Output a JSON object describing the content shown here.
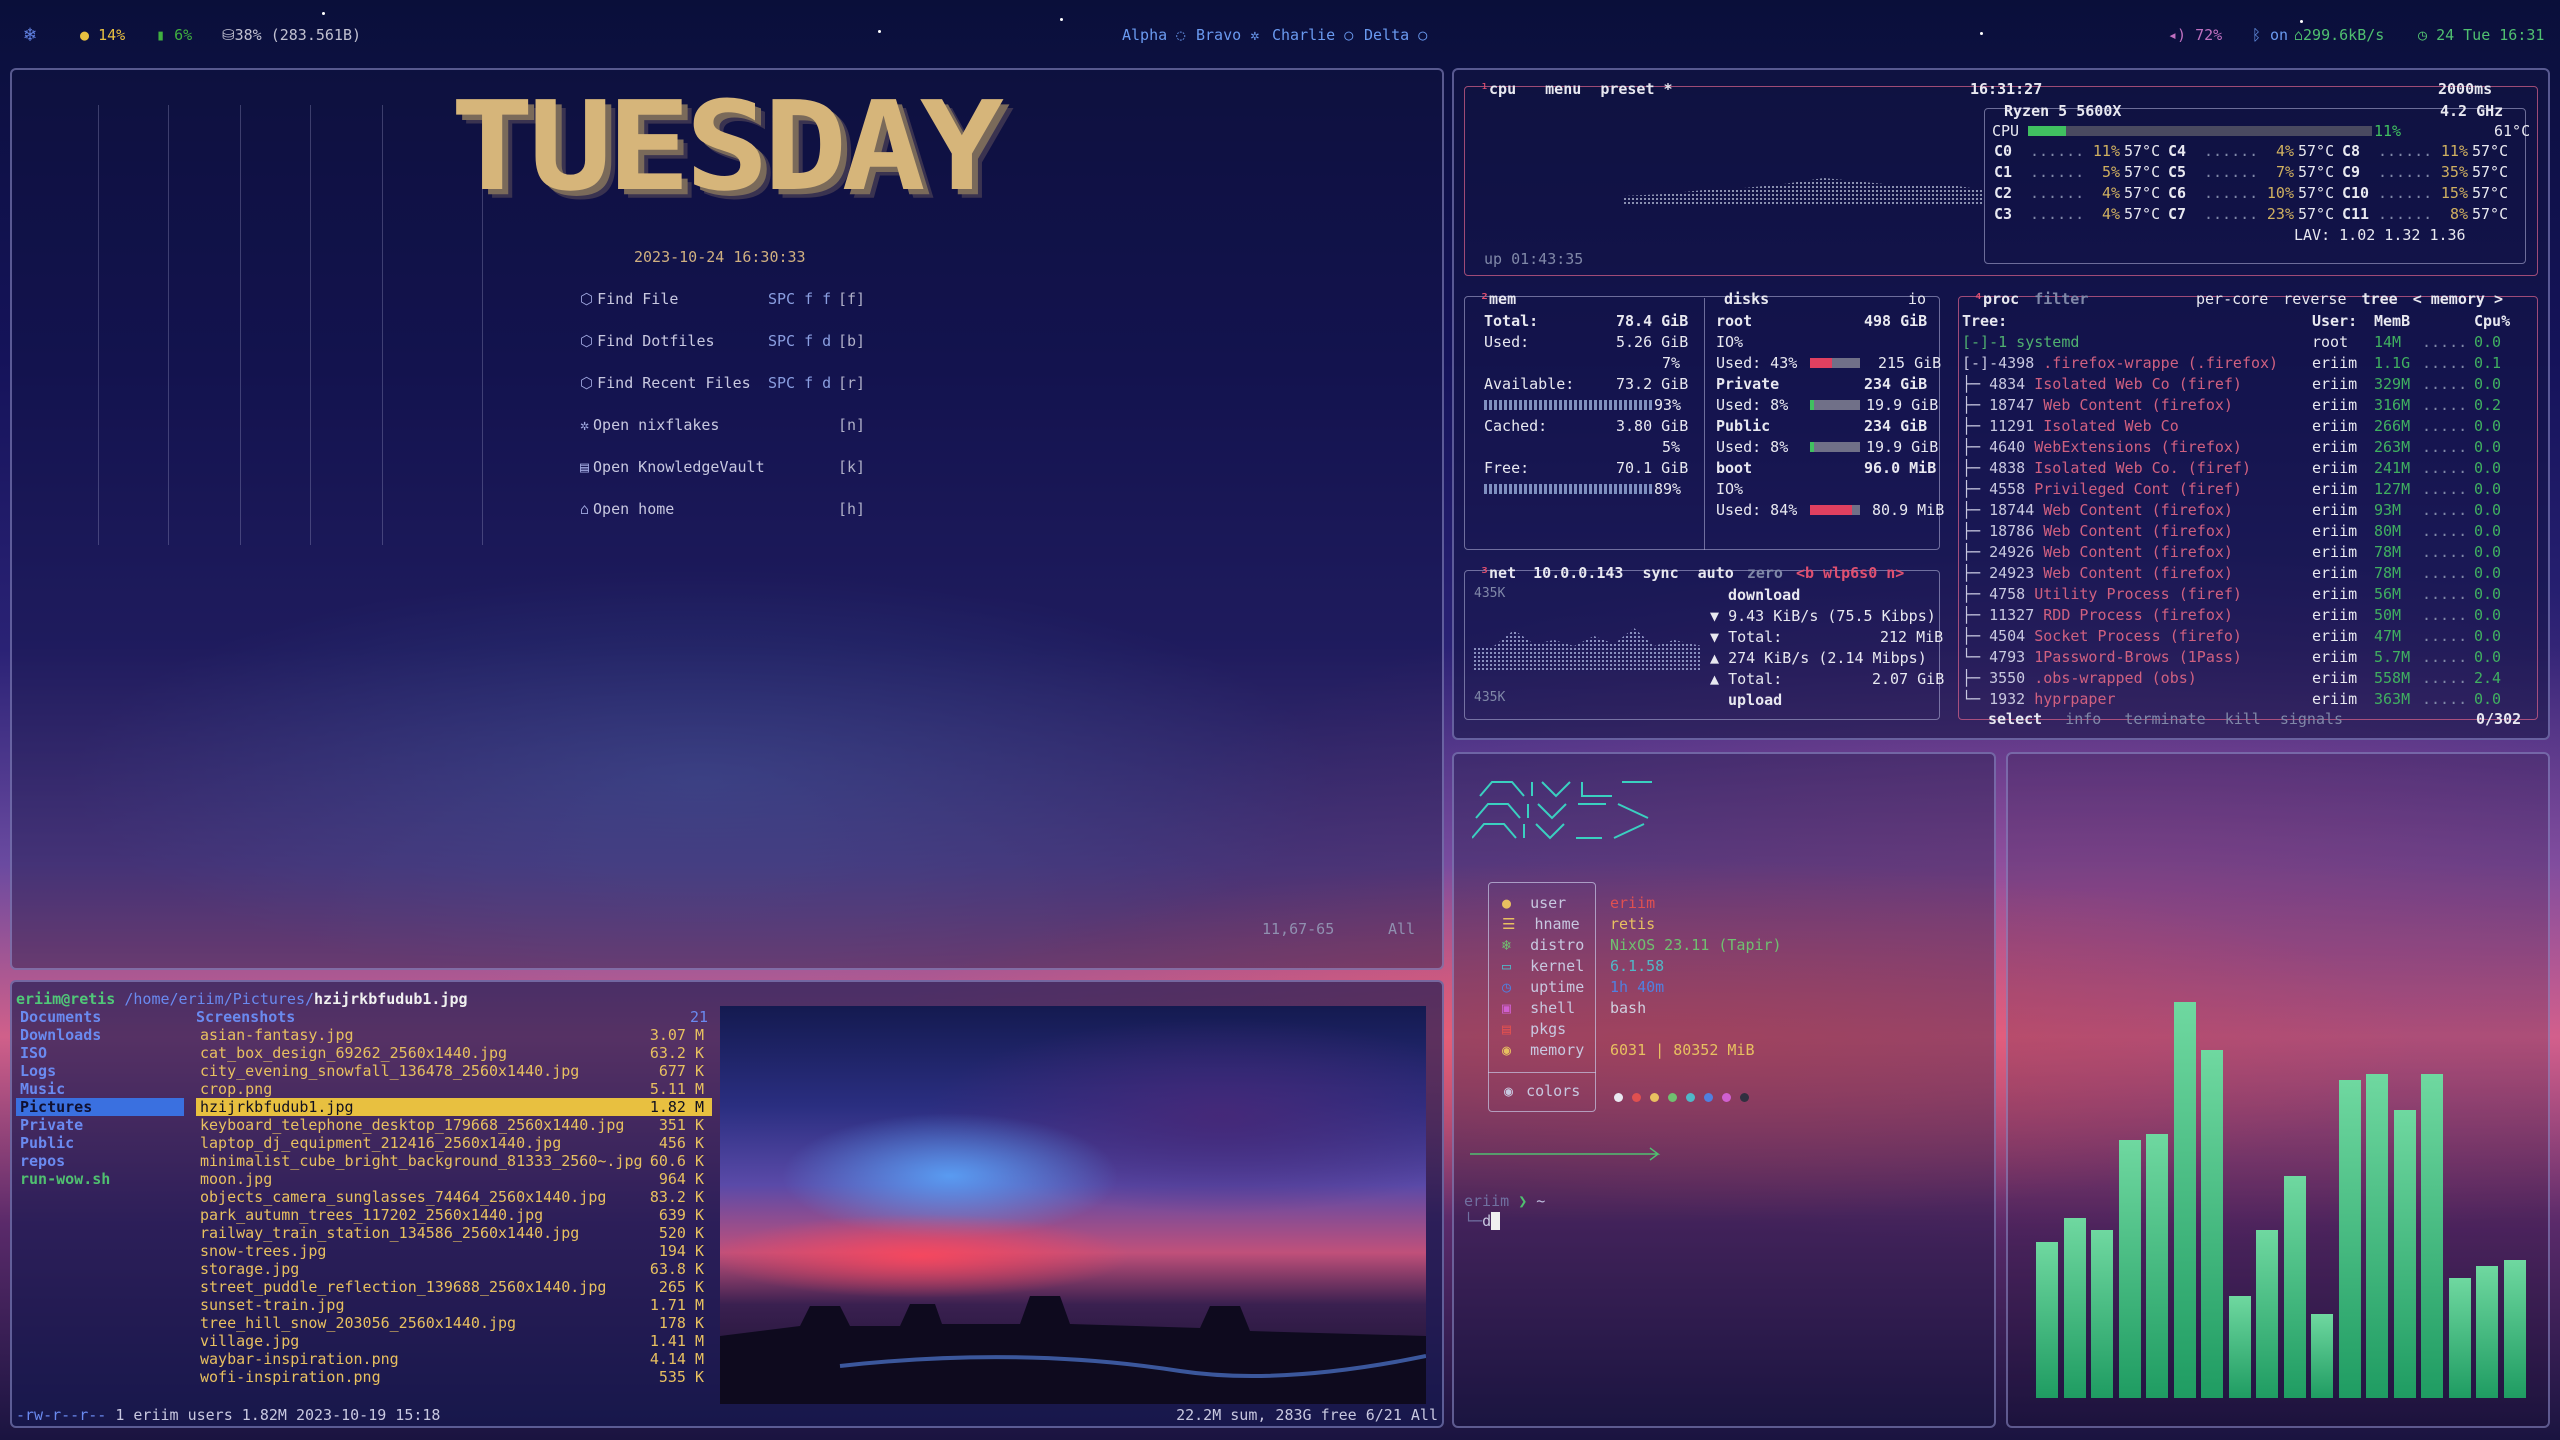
{
  "topbar": {
    "cpu": "14%",
    "mem": "6%",
    "disk": "38% (283.561B)",
    "workspaces": [
      "Alpha",
      "Bravo",
      "Charlie",
      "Delta"
    ],
    "volume": "72%",
    "bluetooth": "on",
    "network": "299.6kB/s",
    "clock": "24 Tue 16:31"
  },
  "dashboard": {
    "banner": "TUESDAY",
    "datetime": "2023-10-24 16:30:33",
    "items": [
      {
        "label": "Find File",
        "key": "SPC f f",
        "bind": "[f]",
        "icon": "file-icon"
      },
      {
        "label": "Find Dotfiles",
        "key": "SPC f d",
        "bind": "[b]",
        "icon": "file-icon"
      },
      {
        "label": "Find Recent Files",
        "key": "SPC f d",
        "bind": "[r]",
        "icon": "file-icon"
      },
      {
        "label": "Open nixflakes",
        "key": "",
        "bind": "[n]",
        "icon": "gear-icon"
      },
      {
        "label": "Open KnowledgeVault",
        "key": "",
        "bind": "[k]",
        "icon": "book-icon"
      },
      {
        "label": "Open home",
        "key": "",
        "bind": "[h]",
        "icon": "home-icon"
      }
    ],
    "position": "11,67-65",
    "scroll": "All"
  },
  "btop": {
    "cpu_header": {
      "tab": "cpu",
      "menu": "menu",
      "preset": "preset *",
      "time": "16:31:27",
      "interval": "2000ms"
    },
    "cpu_model": "Ryzen 5 5600X",
    "cpu_freq": "4.2 GHz",
    "cpu_total": {
      "label": "CPU",
      "pct": "11%",
      "temp": "61°C",
      "fill": 0.11
    },
    "cores": [
      {
        "name": "C0",
        "pct": "11%",
        "temp": "57°C"
      },
      {
        "name": "C1",
        "pct": "5%",
        "temp": "57°C"
      },
      {
        "name": "C2",
        "pct": "4%",
        "temp": "57°C"
      },
      {
        "name": "C3",
        "pct": "4%",
        "temp": "57°C"
      },
      {
        "name": "C4",
        "pct": "4%",
        "temp": "57°C"
      },
      {
        "name": "C5",
        "pct": "7%",
        "temp": "57°C"
      },
      {
        "name": "C6",
        "pct": "10%",
        "temp": "57°C"
      },
      {
        "name": "C7",
        "pct": "23%",
        "temp": "57°C"
      },
      {
        "name": "C8",
        "pct": "11%",
        "temp": "57°C"
      },
      {
        "name": "C9",
        "pct": "35%",
        "temp": "57°C"
      },
      {
        "name": "C10",
        "pct": "15%",
        "temp": "57°C"
      },
      {
        "name": "C11",
        "pct": "8%",
        "temp": "57°C"
      }
    ],
    "lav": "LAV: 1.02 1.32 1.36",
    "uptime": "up 01:43:35",
    "mem": {
      "title": "mem",
      "total_label": "Total:",
      "total": "78.4 GiB",
      "used_label": "Used:",
      "used": "5.26 GiB",
      "used_pct": "7%",
      "avail_label": "Available:",
      "avail": "73.2 GiB",
      "avail_pct": "93%",
      "cached_label": "Cached:",
      "cached": "3.80 GiB",
      "cached_pct": "5%",
      "free_label": "Free:",
      "free": "70.1 GiB",
      "free_pct": "89%"
    },
    "disks": {
      "title": "disks",
      "io": "io",
      "root": {
        "name": "root",
        "size": "498 GiB",
        "io": "IO%",
        "used": "Used: 43%",
        "free": "215 GiB",
        "fill": 0.43
      },
      "private": {
        "name": "Private",
        "size": "234 GiB",
        "used": "Used:  8%",
        "free": "19.9 GiB",
        "fill": 0.08
      },
      "public": {
        "name": "Public",
        "size": "234 GiB",
        "used": "Used:  8%",
        "free": "19.9 GiB",
        "fill": 0.08
      },
      "boot": {
        "name": "boot",
        "size": "96.0 MiB",
        "io": "IO%",
        "used": "Used: 84%",
        "free": "80.9 MiB",
        "fill": 0.84
      }
    },
    "net": {
      "title": "net",
      "ip": "10.0.0.143",
      "sync": "sync",
      "auto": "auto",
      "zero": "zero",
      "iface": "<b wlp6s0 n>",
      "scale_top": "435K",
      "scale_bot": "435K",
      "download": "download",
      "dl_rate": "9.43 KiB/s (75.5 Kibps)",
      "dl_total_label": "Total:",
      "dl_total": "212 MiB",
      "ul_rate": "274 KiB/s (2.14 Mibps)",
      "ul_total_label": "Total:",
      "ul_total": "2.07 GiB",
      "upload": "upload"
    },
    "proc": {
      "title": "proc",
      "filter": "filter",
      "per_core": "per-core",
      "reverse": "reverse",
      "tree": "tree",
      "sort": "< memory >",
      "col_tree": "Tree:",
      "col_user": "User:",
      "col_mem": "MemB",
      "col_cpu": "Cpu%",
      "rows": [
        {
          "tree": "[-]-1 systemd",
          "name": "",
          "user": "root",
          "mem": "14M",
          "cpu": "0.0"
        },
        {
          "tree": " [-]-4398 ",
          "name": ".firefox-wrappe (.firefox)",
          "user": "eriim",
          "mem": "1.1G",
          "cpu": "0.1"
        },
        {
          "tree": "  ├─ 4834 ",
          "name": "Isolated Web Co (firef)",
          "user": "eriim",
          "mem": "329M",
          "cpu": "0.0"
        },
        {
          "tree": "  ├─ 18747 ",
          "name": "Web Content (firefox)",
          "user": "eriim",
          "mem": "316M",
          "cpu": "0.2"
        },
        {
          "tree": "  ├─ 11291 ",
          "name": "Isolated Web Co",
          "user": "eriim",
          "mem": "266M",
          "cpu": "0.0"
        },
        {
          "tree": "  ├─ 4640 ",
          "name": "WebExtensions (firefox)",
          "user": "eriim",
          "mem": "263M",
          "cpu": "0.0"
        },
        {
          "tree": "  ├─ 4838 ",
          "name": "Isolated Web Co. (firef)",
          "user": "eriim",
          "mem": "241M",
          "cpu": "0.0"
        },
        {
          "tree": "  ├─ 4558 ",
          "name": "Privileged Cont (firef)",
          "user": "eriim",
          "mem": "127M",
          "cpu": "0.0"
        },
        {
          "tree": "  ├─ 18744 ",
          "name": "Web Content (firefox)",
          "user": "eriim",
          "mem": "93M",
          "cpu": "0.0"
        },
        {
          "tree": "  ├─ 18786 ",
          "name": "Web Content (firefox)",
          "user": "eriim",
          "mem": "80M",
          "cpu": "0.0"
        },
        {
          "tree": "  ├─ 24926 ",
          "name": "Web Content (firefox)",
          "user": "eriim",
          "mem": "78M",
          "cpu": "0.0"
        },
        {
          "tree": "  ├─ 24923 ",
          "name": "Web Content (firefox)",
          "user": "eriim",
          "mem": "78M",
          "cpu": "0.0"
        },
        {
          "tree": "  ├─ 4758 ",
          "name": "Utility Process (firef)",
          "user": "eriim",
          "mem": "56M",
          "cpu": "0.0"
        },
        {
          "tree": "  ├─ 11327 ",
          "name": "RDD Process (firefox)",
          "user": "eriim",
          "mem": "50M",
          "cpu": "0.0"
        },
        {
          "tree": "  ├─ 4504 ",
          "name": "Socket Process (firefo)",
          "user": "eriim",
          "mem": "47M",
          "cpu": "0.0"
        },
        {
          "tree": "  └─ 4793 ",
          "name": "1Password-Brows (1Pass)",
          "user": "eriim",
          "mem": "5.7M",
          "cpu": "0.0"
        },
        {
          "tree": " ├─ 3550 ",
          "name": ".obs-wrapped (obs)",
          "user": "eriim",
          "mem": "558M",
          "cpu": "2.4"
        },
        {
          "tree": " └─ 1932 ",
          "name": "hyprpaper",
          "user": "eriim",
          "mem": "363M",
          "cpu": "0.0"
        }
      ],
      "footer_select": "select",
      "footer_info": "info",
      "footer_terminate": "terminate",
      "footer_kill": "kill",
      "footer_signals": "signals",
      "count": "0/302"
    }
  },
  "ranger": {
    "header_user": "eriim@retis",
    "header_path": "/home/eriim/Pictures/",
    "header_file": "hzijrkbfudub1.jpg",
    "left": [
      "Documents",
      "Downloads",
      "ISO",
      "Logs",
      "Music",
      "Pictures",
      "Private",
      "Public",
      "repos",
      "run-wow.sh"
    ],
    "left_selected": 5,
    "mid_header": "Screenshots",
    "mid_header_count": "21",
    "files": [
      {
        "name": "asian-fantasy.jpg",
        "size": "3.07 M"
      },
      {
        "name": "cat_box_design_69262_2560x1440.jpg",
        "size": "63.2 K"
      },
      {
        "name": "city_evening_snowfall_136478_2560x1440.jpg",
        "size": "677 K"
      },
      {
        "name": "crop.png",
        "size": "5.11 M"
      },
      {
        "name": "hzijrkbfudub1.jpg",
        "size": "1.82 M"
      },
      {
        "name": "keyboard_telephone_desktop_179668_2560x1440.jpg",
        "size": "351 K"
      },
      {
        "name": "laptop_dj_equipment_212416_2560x1440.jpg",
        "size": "456 K"
      },
      {
        "name": "minimalist_cube_bright_background_81333_2560~.jpg",
        "size": "60.6 K"
      },
      {
        "name": "moon.jpg",
        "size": "964 K"
      },
      {
        "name": "objects_camera_sunglasses_74464_2560x1440.jpg",
        "size": "83.2 K"
      },
      {
        "name": "park_autumn_trees_117202_2560x1440.jpg",
        "size": "639 K"
      },
      {
        "name": "railway_train_station_134586_2560x1440.jpg",
        "size": "520 K"
      },
      {
        "name": "snow-trees.jpg",
        "size": "194 K"
      },
      {
        "name": "storage.jpg",
        "size": "63.8 K"
      },
      {
        "name": "street_puddle_reflection_139688_2560x1440.jpg",
        "size": "265 K"
      },
      {
        "name": "sunset-train.jpg",
        "size": "1.71 M"
      },
      {
        "name": "tree_hill_snow_203056_2560x1440.jpg",
        "size": "178 K"
      },
      {
        "name": "village.jpg",
        "size": "1.41 M"
      },
      {
        "name": "waybar-inspiration.png",
        "size": "4.14 M"
      },
      {
        "name": "wofi-inspiration.png",
        "size": "535 K"
      }
    ],
    "selected_index": 4,
    "status_perms": "-rw-r--r--",
    "status_info": "1 eriim users 1.82M 2023-10-19 15:18",
    "status_right": "22.2M sum, 283G free  6/21  All"
  },
  "neofetch": {
    "rows": [
      {
        "icon": "user-icon",
        "key": "user",
        "val": "eriim",
        "color": "#e05050"
      },
      {
        "icon": "host-icon",
        "key": "hname",
        "val": "retis",
        "color": "#e8c060"
      },
      {
        "icon": "distro-icon",
        "key": "distro",
        "val": "NixOS 23.11 (Tapir)",
        "color": "#70c070"
      },
      {
        "icon": "kernel-icon",
        "key": "kernel",
        "val": "6.1.58",
        "color": "#50b8c8"
      },
      {
        "icon": "uptime-icon",
        "key": "uptime",
        "val": "1h 40m",
        "color": "#5080e0"
      },
      {
        "icon": "shell-icon",
        "key": "shell",
        "val": "bash",
        "color": "#d0d0e0"
      },
      {
        "icon": "pkgs-icon",
        "key": "pkgs",
        "val": "",
        "color": "#d0d0e0"
      },
      {
        "icon": "memory-icon",
        "key": "memory",
        "val": "6031 | 80352 MiB",
        "color": "#e8c060"
      }
    ],
    "colors_label": "colors",
    "palette": [
      "#e8e8f0",
      "#e05050",
      "#e8c060",
      "#70c070",
      "#50b8c8",
      "#5080e0",
      "#d060d0",
      "#303040"
    ],
    "prompt_user": "eriim",
    "prompt_cmd": "~",
    "prompt_input": "d"
  },
  "cava": {
    "levels": [
      0.26,
      0.3,
      0.28,
      0.43,
      0.44,
      0.66,
      0.58,
      0.17,
      0.28,
      0.37,
      0.14,
      0.53,
      0.54,
      0.48,
      0.54,
      0.2,
      0.22,
      0.23
    ]
  }
}
